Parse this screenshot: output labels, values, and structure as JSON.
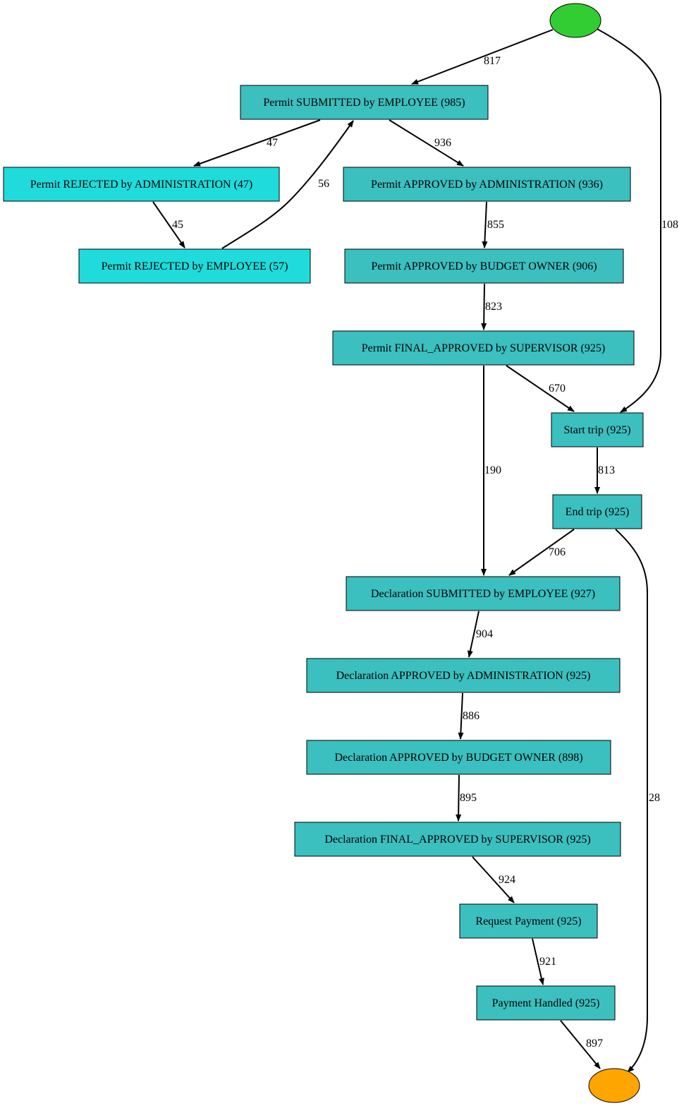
{
  "colors": {
    "activity": "#3bbfbf",
    "rejected": "#1fdbdb",
    "start": "#32cd32",
    "end": "#ffa500",
    "edge": "#000000"
  },
  "nodes": [
    {
      "id": "start",
      "shape": "ellipse",
      "color": "start"
    },
    {
      "id": "end",
      "shape": "ellipse",
      "color": "end"
    },
    {
      "id": "n1",
      "label": "Permit SUBMITTED by EMPLOYEE (985)",
      "color": "activity"
    },
    {
      "id": "n2",
      "label": "Permit REJECTED by ADMINISTRATION (47)",
      "color": "rejected"
    },
    {
      "id": "n3",
      "label": "Permit APPROVED by ADMINISTRATION (936)",
      "color": "activity"
    },
    {
      "id": "n4",
      "label": "Permit REJECTED by EMPLOYEE (57)",
      "color": "rejected"
    },
    {
      "id": "n5",
      "label": "Permit APPROVED by BUDGET OWNER (906)",
      "color": "activity"
    },
    {
      "id": "n6",
      "label": "Permit FINAL_APPROVED by SUPERVISOR (925)",
      "color": "activity"
    },
    {
      "id": "n7",
      "label": "Start trip (925)",
      "color": "activity"
    },
    {
      "id": "n8",
      "label": "End trip (925)",
      "color": "activity"
    },
    {
      "id": "n9",
      "label": "Declaration SUBMITTED by EMPLOYEE (927)",
      "color": "activity"
    },
    {
      "id": "n10",
      "label": "Declaration APPROVED by ADMINISTRATION (925)",
      "color": "activity"
    },
    {
      "id": "n11",
      "label": "Declaration APPROVED by BUDGET OWNER (898)",
      "color": "activity"
    },
    {
      "id": "n12",
      "label": "Declaration FINAL_APPROVED by SUPERVISOR (925)",
      "color": "activity"
    },
    {
      "id": "n13",
      "label": "Request Payment (925)",
      "color": "activity"
    },
    {
      "id": "n14",
      "label": "Payment Handled (925)",
      "color": "activity"
    }
  ],
  "edges": [
    {
      "from": "start",
      "to": "n1",
      "label": "817"
    },
    {
      "from": "start",
      "to": "n7",
      "label": "108"
    },
    {
      "from": "n1",
      "to": "n2",
      "label": "47"
    },
    {
      "from": "n1",
      "to": "n3",
      "label": "936"
    },
    {
      "from": "n2",
      "to": "n4",
      "label": "45"
    },
    {
      "from": "n4",
      "to": "n1",
      "label": "56"
    },
    {
      "from": "n3",
      "to": "n5",
      "label": "855"
    },
    {
      "from": "n5",
      "to": "n6",
      "label": "823"
    },
    {
      "from": "n6",
      "to": "n7",
      "label": "670"
    },
    {
      "from": "n6",
      "to": "n9",
      "label": "190"
    },
    {
      "from": "n7",
      "to": "n8",
      "label": "813"
    },
    {
      "from": "n8",
      "to": "n9",
      "label": "706"
    },
    {
      "from": "n8",
      "to": "end",
      "label": "28"
    },
    {
      "from": "n9",
      "to": "n10",
      "label": "904"
    },
    {
      "from": "n10",
      "to": "n11",
      "label": "886"
    },
    {
      "from": "n11",
      "to": "n12",
      "label": "895"
    },
    {
      "from": "n12",
      "to": "n13",
      "label": "924"
    },
    {
      "from": "n13",
      "to": "n14",
      "label": "921"
    },
    {
      "from": "n14",
      "to": "end",
      "label": "897"
    }
  ]
}
